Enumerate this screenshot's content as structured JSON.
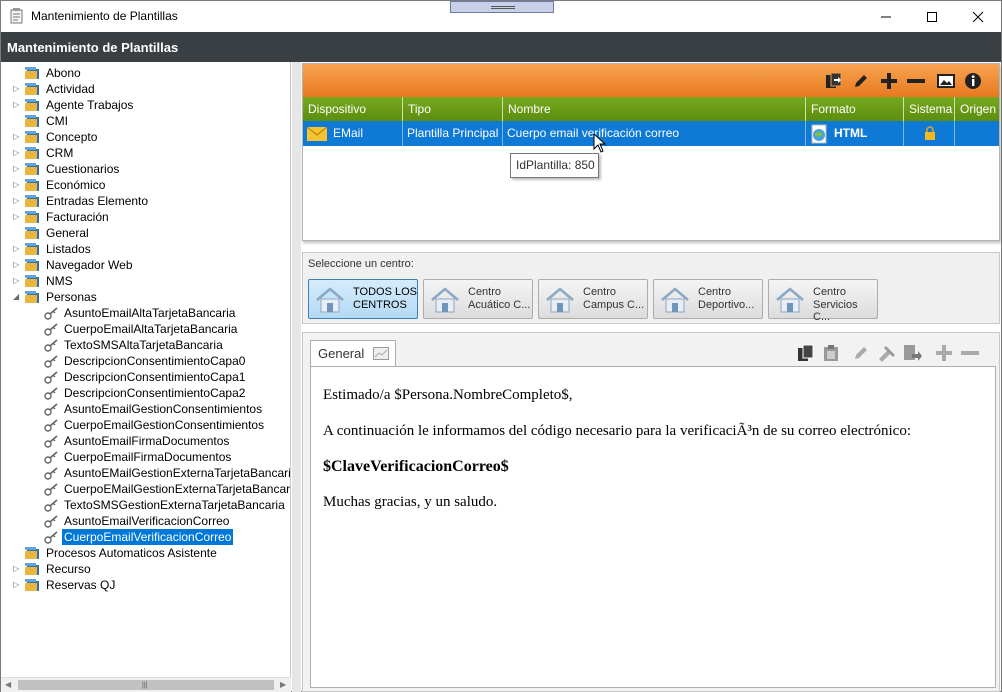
{
  "window": {
    "title": "Mantenimiento de Plantillas"
  },
  "header": {
    "title": "Mantenimiento de Plantillas"
  },
  "tree": {
    "items": [
      {
        "label": "Abono",
        "expandable": false
      },
      {
        "label": "Actividad",
        "expandable": true
      },
      {
        "label": "Agente Trabajos",
        "expandable": true
      },
      {
        "label": "CMI",
        "expandable": false
      },
      {
        "label": "Concepto",
        "expandable": true
      },
      {
        "label": "CRM",
        "expandable": true
      },
      {
        "label": "Cuestionarios",
        "expandable": true
      },
      {
        "label": "Económico",
        "expandable": true
      },
      {
        "label": "Entradas Elemento",
        "expandable": true
      },
      {
        "label": "Facturación",
        "expandable": true
      },
      {
        "label": "General",
        "expandable": false
      },
      {
        "label": "Listados",
        "expandable": true
      },
      {
        "label": "Navegador Web",
        "expandable": true
      },
      {
        "label": "NMS",
        "expandable": true
      },
      {
        "label": "Personas",
        "expandable": true,
        "expanded": true
      }
    ],
    "personas_children": [
      "AsuntoEmailAltaTarjetaBancaria",
      "CuerpoEmailAltaTarjetaBancaria",
      "TextoSMSAltaTarjetaBancaria",
      "DescripcionConsentimientoCapa0",
      "DescripcionConsentimientoCapa1",
      "DescripcionConsentimientoCapa2",
      "AsuntoEmailGestionConsentimientos",
      "CuerpoEmailGestionConsentimientos",
      "AsuntoEmailFirmaDocumentos",
      "CuerpoEmailFirmaDocumentos",
      "AsuntoEMailGestionExternaTarjetaBancaria",
      "CuerpoEMailGestionExternaTarjetaBancaria",
      "TextoSMSGestionExternaTarjetaBancaria",
      "AsuntoEmailVerificacionCorreo",
      "CuerpoEmailVerificacionCorreo"
    ],
    "selected": "CuerpoEmailVerificacionCorreo",
    "after_items": [
      {
        "label": "Procesos Automaticos Asistente",
        "expandable": false
      },
      {
        "label": "Recurso",
        "expandable": true
      },
      {
        "label": "Reservas QJ",
        "expandable": true
      }
    ]
  },
  "grid": {
    "columns": [
      "Dispositivo",
      "Tipo",
      "Nombre",
      "Formato",
      "Sistema",
      "Origen"
    ],
    "rows": [
      {
        "dispositivo": "EMail",
        "tipo": "Plantilla Principal",
        "nombre": "Cuerpo email verificación correo",
        "formato": "HTML",
        "sistema": "lock-icon",
        "origen": ""
      }
    ],
    "tooltip": "IdPlantilla: 850"
  },
  "centers": {
    "caption": "Seleccione un centro:",
    "buttons": [
      {
        "line1": "TODOS LOS",
        "line2": "CENTROS",
        "active": true
      },
      {
        "line1": "Centro",
        "line2": "Acuático C...",
        "active": false
      },
      {
        "line1": "Centro",
        "line2": "Campus C...",
        "active": false
      },
      {
        "line1": "Centro",
        "line2": "Deportivo...",
        "active": false
      },
      {
        "line1": "Centro",
        "line2": "Servicios C...",
        "active": false
      }
    ]
  },
  "editor": {
    "tab_label": "General",
    "content": {
      "p1": "Estimado/a $Persona.NombreCompleto$,",
      "p2": "A continuación le informamos del código necesario para la verificaciÃ³n de su correo electrónico:",
      "p3": "$ClaveVerificacionCorreo$",
      "p4": "Muchas gracias, y un saludo."
    }
  },
  "colors": {
    "header_bg": "#3a3f44",
    "orange_bar": "#e8791f",
    "green_header": "#5b8d10",
    "selection": "#0078d7"
  }
}
